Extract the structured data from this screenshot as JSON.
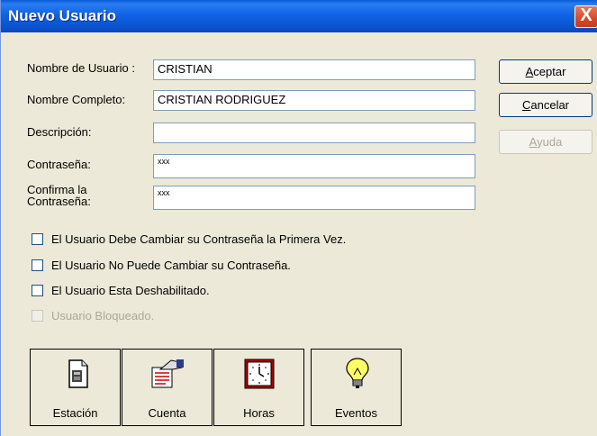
{
  "window": {
    "title": "Nuevo Usuario",
    "close_label": "X"
  },
  "fields": [
    {
      "label": "Nombre de Usuario :",
      "value": "CRISTIAN"
    },
    {
      "label": "Nombre Completo:",
      "value": "CRISTIAN RODRIGUEZ"
    },
    {
      "label": "Descripción:",
      "value": ""
    },
    {
      "label": "Contraseña:",
      "value": "xxx"
    },
    {
      "label_line1": "Confirma la",
      "label_line2": "Contraseña:",
      "value": "xxx"
    }
  ],
  "buttons": {
    "aceptar": {
      "underline": "A",
      "rest": "ceptar"
    },
    "cancelar": {
      "underline": "C",
      "rest": "ancelar"
    },
    "ayuda": {
      "underline": "A",
      "rest": "yuda"
    }
  },
  "options": [
    {
      "label": "El Usuario Debe Cambiar su Contraseña la Primera Vez.",
      "checked": false,
      "enabled": true
    },
    {
      "label": "El Usuario No Puede Cambiar su Contraseña.",
      "checked": false,
      "enabled": true
    },
    {
      "label": "El Usuario Esta Deshabilitado.",
      "checked": false,
      "enabled": true
    },
    {
      "label": "Usuario Bloqueado.",
      "checked": false,
      "enabled": false
    }
  ],
  "tools": [
    {
      "label": "Estación",
      "icon": "station-icon"
    },
    {
      "label": "Cuenta",
      "icon": "account-icon"
    },
    {
      "label": "Horas",
      "icon": "clock-icon"
    },
    {
      "label": "Eventos",
      "icon": "lightbulb-icon"
    }
  ]
}
